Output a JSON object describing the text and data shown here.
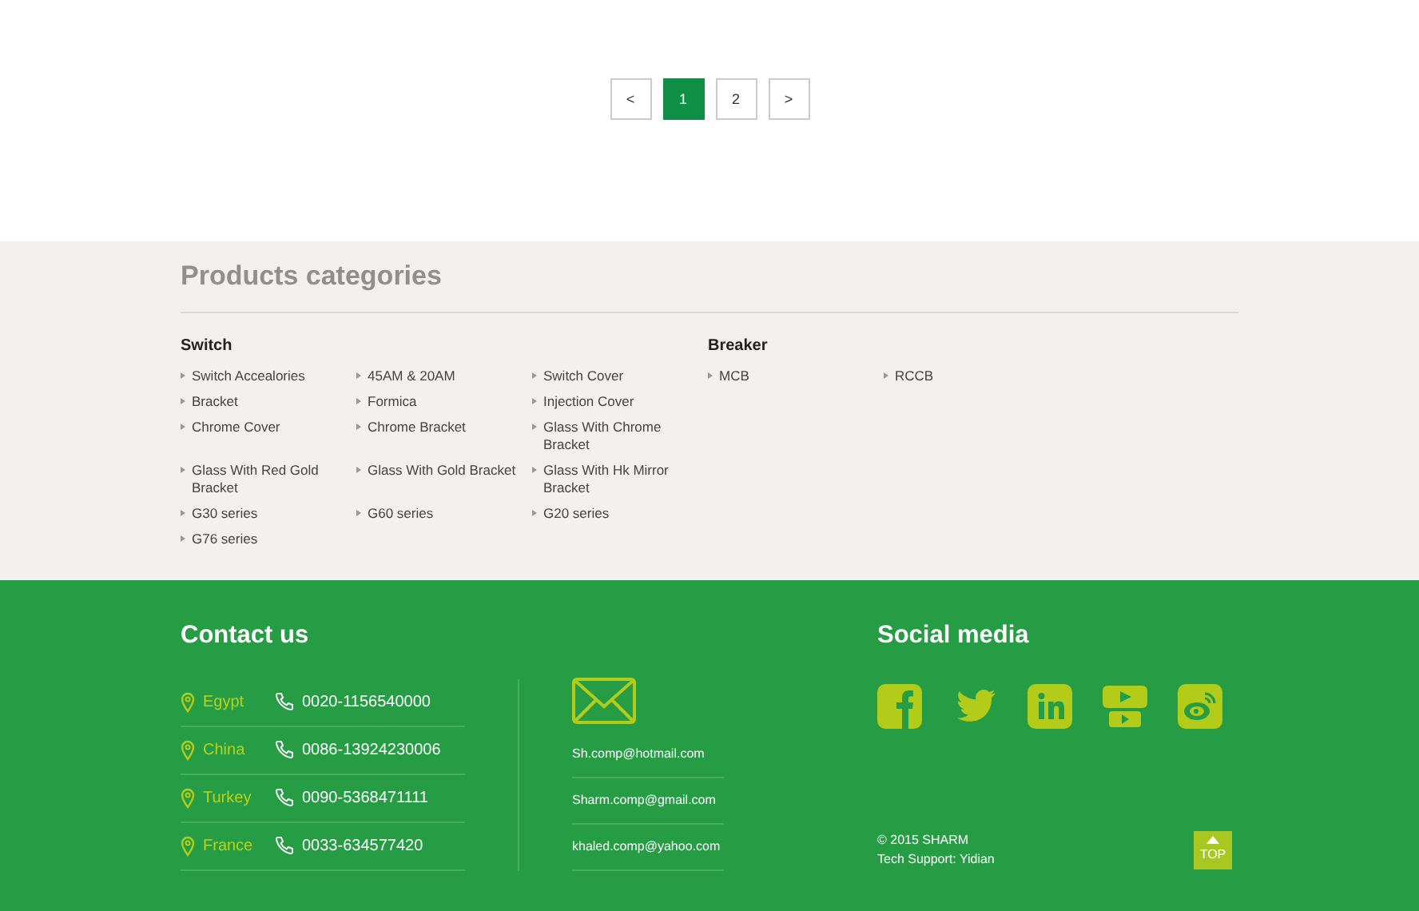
{
  "pagination": [
    {
      "label": "<",
      "selected": false
    },
    {
      "label": "1",
      "selected": true
    },
    {
      "label": "2",
      "selected": false
    },
    {
      "label": ">",
      "selected": false
    }
  ],
  "products": {
    "title": "Products categories",
    "groups": [
      {
        "title": "Switch",
        "items": [
          "Switch Accealories",
          "45AM & 20AM",
          "Switch Cover",
          "Bracket",
          "Formica",
          "Injection Cover",
          "Chrome Cover",
          "Chrome Bracket",
          "Glass With Chrome Bracket",
          "Glass With Red Gold Bracket",
          "Glass With Gold Bracket",
          "Glass With Hk Mirror Bracket",
          "G30 series",
          "G60 series",
          "G20 series",
          "G76 series"
        ]
      },
      {
        "title": "Breaker",
        "items": [
          "MCB",
          "RCCB"
        ]
      }
    ]
  },
  "contact": {
    "title": "Contact us",
    "offices": [
      {
        "country": "Egypt",
        "phone": "0020-1156540000"
      },
      {
        "country": "China",
        "phone": "0086-13924230006"
      },
      {
        "country": "Turkey",
        "phone": "0090-5368471111"
      },
      {
        "country": "France",
        "phone": "0033-634577420"
      }
    ],
    "emails": [
      "Sh.comp@hotmail.com",
      "Sharm.comp@gmail.com",
      "khaled.comp@yahoo.com"
    ]
  },
  "social": {
    "title": "Social media",
    "links": [
      {
        "kind": "facebook"
      },
      {
        "kind": "twitter"
      },
      {
        "kind": "linkedin"
      },
      {
        "kind": "youtube"
      },
      {
        "kind": "weibo"
      }
    ]
  },
  "copyright": [
    "© 2015 SHARM",
    "Tech Support: Yidian"
  ],
  "top_button": {
    "label": "TOP"
  }
}
